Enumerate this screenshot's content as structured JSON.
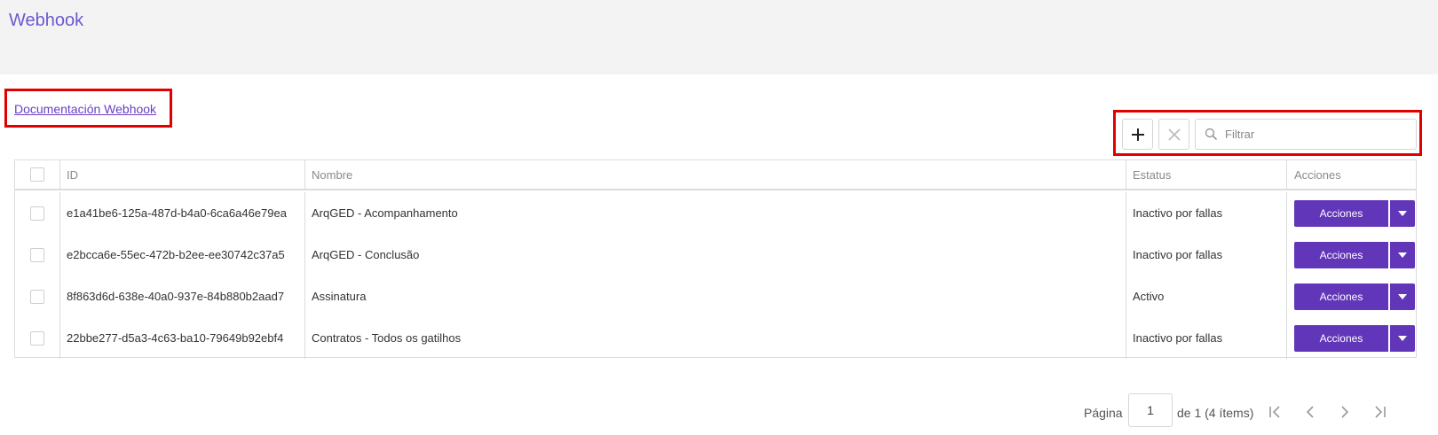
{
  "header": {
    "title": "Webhook"
  },
  "doc_link": {
    "label": "Documentación Webhook"
  },
  "toolbar": {
    "add_icon": "plus-icon",
    "clear_icon": "close-icon",
    "filter_placeholder": "Filtrar"
  },
  "table": {
    "columns": [
      "ID",
      "Nombre",
      "Estatus",
      "Acciones"
    ],
    "rows": [
      {
        "id": "e1a41be6-125a-487d-b4a0-6ca6a46e79ea",
        "name": "ArqGED - Acompanhamento",
        "status": "Inactivo por fallas",
        "action": "Acciones"
      },
      {
        "id": "e2bcca6e-55ec-472b-b2ee-ee30742c37a5",
        "name": "ArqGED - Conclusão",
        "status": "Inactivo por fallas",
        "action": "Acciones"
      },
      {
        "id": "8f863d6d-638e-40a0-937e-84b880b2aad7",
        "name": "Assinatura",
        "status": "Activo",
        "action": "Acciones"
      },
      {
        "id": "22bbe277-d5a3-4c63-ba10-79649b92ebf4",
        "name": "Contratos - Todos os gatilhos",
        "status": "Inactivo por fallas",
        "action": "Acciones"
      }
    ]
  },
  "pagination": {
    "label": "Página",
    "current": "1",
    "of_text": "de 1 (4 ítems)"
  },
  "colors": {
    "accent": "#6136b8",
    "title": "#6a5ad0",
    "highlight": "#e00000"
  }
}
